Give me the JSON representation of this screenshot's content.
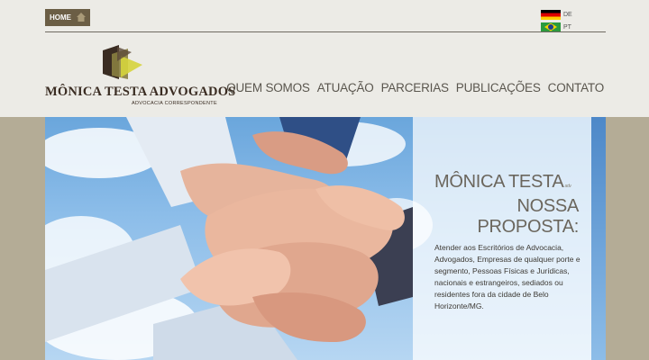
{
  "topbar": {
    "home_label": "HOME",
    "languages": [
      {
        "code": "DE",
        "flag": "germany-flag-icon"
      },
      {
        "code": "PT",
        "flag": "brazil-flag-icon"
      }
    ]
  },
  "logo": {
    "name": "MÔNICA TESTA ADVOGADOS",
    "subtitle": "ADVOCACIA CORRESPONDENTE",
    "colors": {
      "dark": "#3a2c22",
      "olive": "#8a8040",
      "lime": "#d6d43c"
    }
  },
  "nav": {
    "items": [
      "QUEM SOMOS",
      "ATUAÇÃO",
      "PARCERIAS",
      "PUBLICAÇÕES",
      "CONTATO"
    ]
  },
  "hero": {
    "brand": "MÔNICA TESTA",
    "brand_suffix": "adv",
    "heading_line1": "NOSSA",
    "heading_line2": "PROPOSTA:",
    "body": "Atender aos Escritórios de Advocacia, Advogados, Empresas de qualquer porte e segmento, Pessoas Físicas e Jurídicas, nacionais e estrangeiros, sediados ou residentes fora da cidade de Belo Horizonte/MG."
  },
  "colors": {
    "header_bg": "#ecebe6",
    "page_bg": "#b4ac96",
    "home_button": "#6b5e45",
    "nav_text": "#5a564e",
    "sky": "#8cbde9"
  }
}
